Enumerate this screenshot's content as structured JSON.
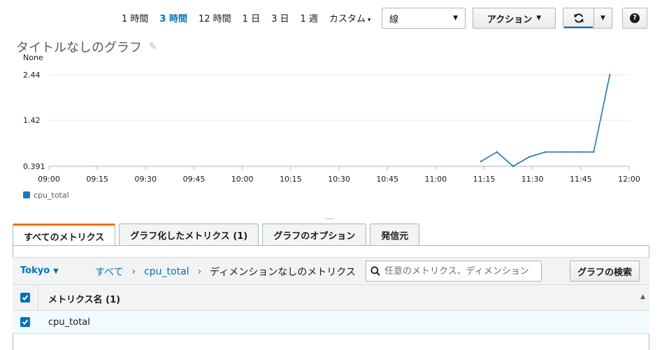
{
  "toolbar": {
    "time_ranges": [
      {
        "label": "1 時間",
        "active": false
      },
      {
        "label": "3 時間",
        "active": true
      },
      {
        "label": "12 時間",
        "active": false
      },
      {
        "label": "1 日",
        "active": false
      },
      {
        "label": "3 日",
        "active": false
      },
      {
        "label": "1 週",
        "active": false
      }
    ],
    "custom_label": "カスタム",
    "graph_type": "線",
    "actions_label": "アクション",
    "refresh_icon": "refresh-icon",
    "help_icon": "help-icon",
    "help_glyph": "?"
  },
  "graph": {
    "title": "タイトルなしのグラフ",
    "edit_icon": "pencil-icon",
    "legend_series": "cpu_total",
    "series_color": "#1f77b4"
  },
  "chart_data": {
    "type": "line",
    "ylabel": "None",
    "y_ticks": [
      "2.44",
      "1.42",
      "0.391"
    ],
    "ylim": [
      0.391,
      2.44
    ],
    "x_ticks": [
      "09:00",
      "09:15",
      "09:30",
      "09:45",
      "10:00",
      "10:15",
      "10:30",
      "10:45",
      "11:00",
      "11:15",
      "11:30",
      "11:45",
      "12:00"
    ],
    "xlim_minutes": [
      540,
      720
    ],
    "series": [
      {
        "name": "cpu_total",
        "x": [
          "11:14",
          "11:19",
          "11:24",
          "11:29",
          "11:34",
          "11:39",
          "11:44",
          "11:49",
          "11:54"
        ],
        "y": [
          0.5,
          0.71,
          0.391,
          0.6,
          0.71,
          0.71,
          0.71,
          0.71,
          2.44
        ]
      }
    ],
    "grid": true,
    "legend": "bottom-left"
  },
  "divider_text": "---",
  "tabs": [
    {
      "label": "すべてのメトリクス",
      "active": true
    },
    {
      "label": "グラフ化したメトリクス (1)",
      "active": false
    },
    {
      "label": "グラフのオプション",
      "active": false
    },
    {
      "label": "発信元",
      "active": false
    }
  ],
  "browse": {
    "region": "Tokyo",
    "breadcrumbs": [
      "すべて",
      "cpu_total",
      "ディメンションなしのメトリクス"
    ],
    "search_placeholder": "任意のメトリクス、ディメンション",
    "search_button": "グラフの検索"
  },
  "table": {
    "header": "メトリクス名 (1)",
    "rows": [
      {
        "name": "cpu_total",
        "checked": true
      }
    ]
  }
}
